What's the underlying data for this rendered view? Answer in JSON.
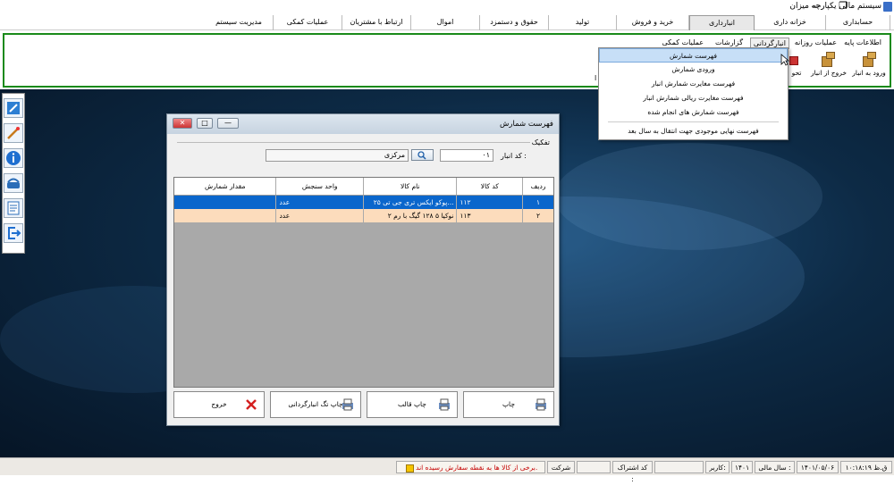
{
  "app": {
    "title": "سیستم مالی یکپارچه میزان",
    "win_min": "—",
    "win_restore": "❐"
  },
  "main_menu": [
    {
      "label": "حسابداری"
    },
    {
      "label": "خزانه داری"
    },
    {
      "label": "انبارداری"
    },
    {
      "label": "خرید و فروش"
    },
    {
      "label": "تولید"
    },
    {
      "label": "حقوق و دستمزد"
    },
    {
      "label": "اموال"
    },
    {
      "label": "ارتباط با مشتریان"
    },
    {
      "label": "عملیات کمکی"
    },
    {
      "label": "مدیریت سیستم"
    }
  ],
  "ribbon": {
    "tabs": [
      {
        "label": "اطلاعات پایه"
      },
      {
        "label": "عملیات روزانه"
      },
      {
        "label": "انبارگردانی"
      },
      {
        "label": "گزارشات"
      },
      {
        "label": "عملیات کمکی"
      }
    ],
    "buttons": [
      {
        "label": "ورود به انبار"
      },
      {
        "label": "خروج از انبار"
      },
      {
        "label": "تحو"
      }
    ],
    "stray_char": "ا"
  },
  "dropdown": {
    "items": [
      {
        "label": "فهرست شمارش"
      },
      {
        "label": "ورودی شمارش"
      },
      {
        "label": "فهرست مغایرت شمارش انبار"
      },
      {
        "label": "فهرست مغایرت ریالی شمارش انبار"
      },
      {
        "label": "فهرست شمارش های انجام شده"
      },
      {
        "label": "فهرست نهایی موجودی جهت انتقال به سال بعد"
      }
    ]
  },
  "dialog": {
    "title": "فهرست شمارش",
    "group_label": "تفکیک",
    "warehouse_code_label": "کد انبار :",
    "warehouse_code_value": "۰۱",
    "warehouse_name": "مرکزی",
    "btn_close": "✕",
    "btn_max": "□",
    "btn_min": "—",
    "grid": {
      "columns": [
        "ردیف",
        "کد کالا",
        "نام کالا",
        "واحد سنجش",
        "مقدار شمارش"
      ],
      "rows": [
        [
          "۱",
          "۱۱۲",
          "پوکو ایکس تری جی تی ۲۵...",
          "عدد",
          ""
        ],
        [
          "۲",
          "۱۱۳",
          "نوکیا ۵ ۱۲۸ گیگ با رم ۲",
          "عدد",
          ""
        ]
      ]
    },
    "actions": [
      {
        "label": "چاپ"
      },
      {
        "label": "چاپ قالب"
      },
      {
        "label": "چاپ تگ انبارگردانی"
      },
      {
        "label": "خروج"
      }
    ]
  },
  "status_bar": {
    "time": "۱۰:۱۸:۱۹ ق.ظ",
    "date": "۱۴۰۱/۰۵/۰۶",
    "fiscal_year_label": "سال مالی :",
    "fiscal_year_value": "۱۴۰۱",
    "user_label": "کاربر:",
    "user_value": "",
    "subscription_label": "کد اشتراک :",
    "subscription_value": "",
    "company_label": "شرکت",
    "warning": "برخی از کالا ها به نقطه سفارش رسیده اند."
  },
  "colors": {
    "ribbon_border": "#1a8a1a",
    "selection": "#0a66cc",
    "alt_row": "#fcdcbc",
    "warning_text": "#c40000"
  }
}
